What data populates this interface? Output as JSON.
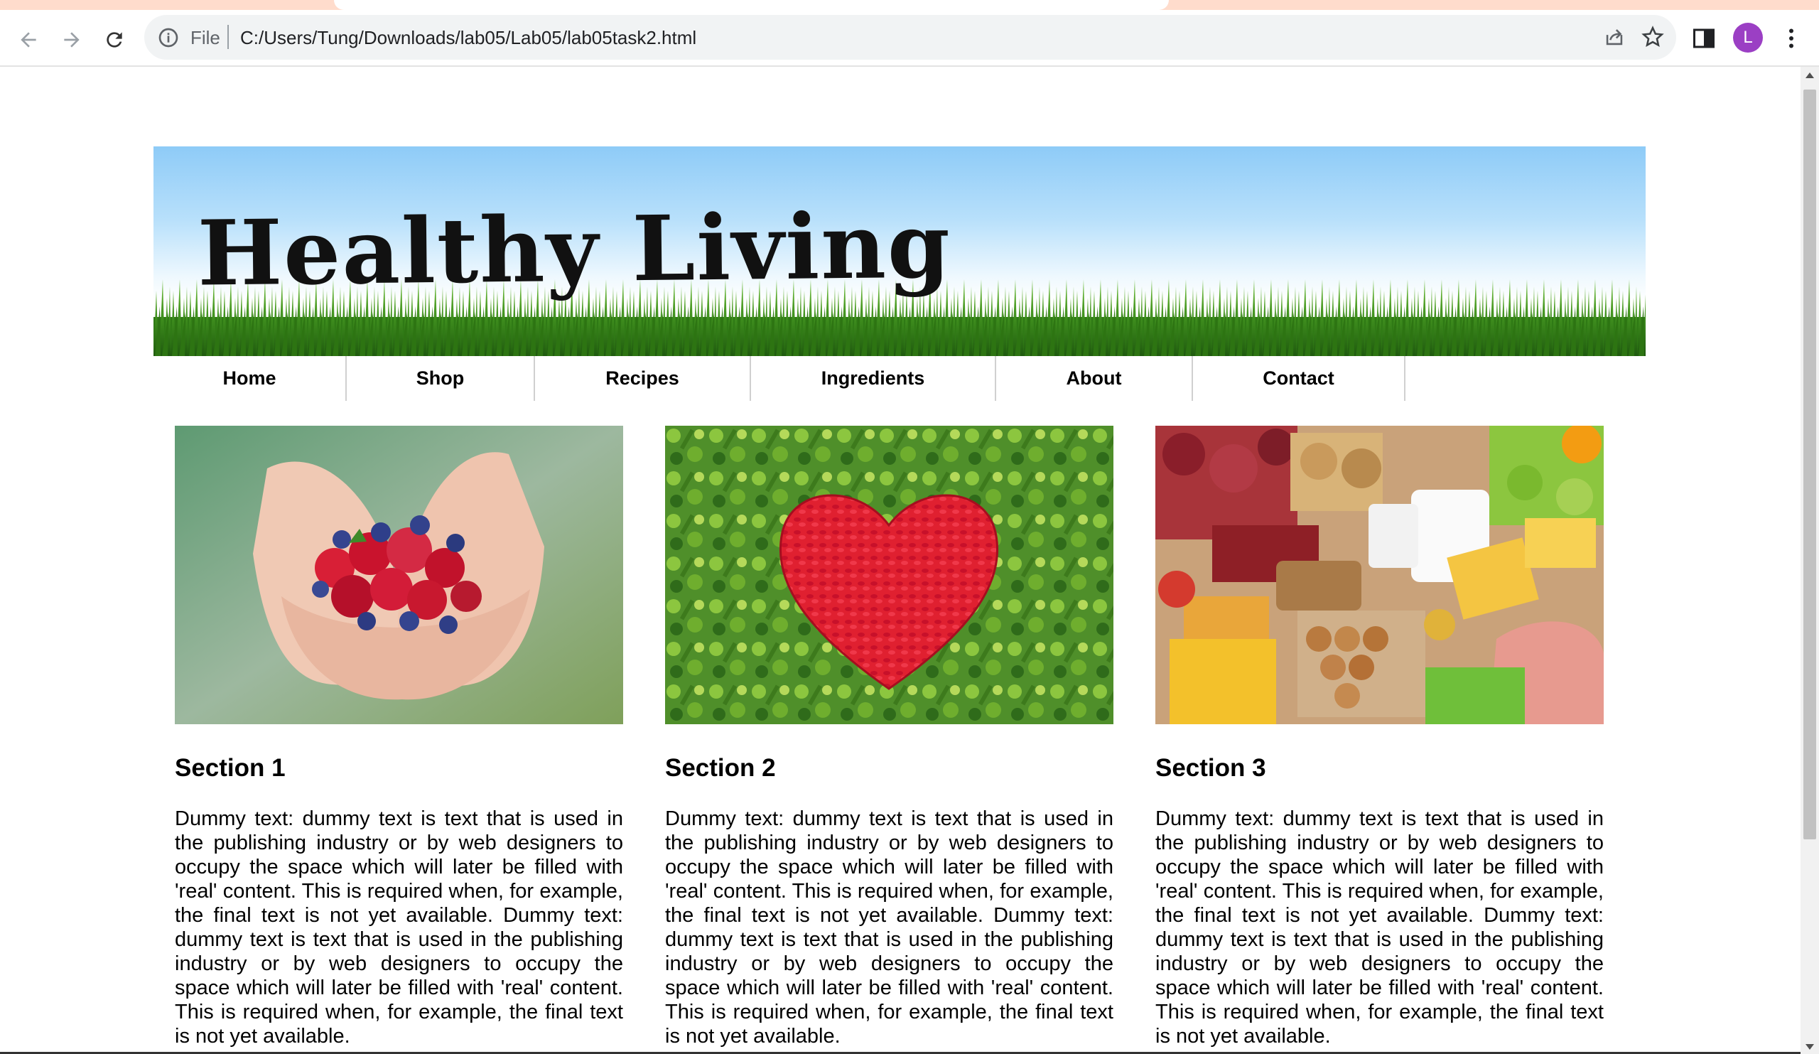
{
  "browser": {
    "scheme_label": "File",
    "url": "C:/Users/Tung/Downloads/lab05/Lab05/lab05task2.html",
    "profile_initial": "L",
    "profile_color": "#9b3fc4"
  },
  "site": {
    "title": "Healthy Living"
  },
  "nav": [
    {
      "label": "Home"
    },
    {
      "label": "Shop"
    },
    {
      "label": "Recipes"
    },
    {
      "label": "Ingredients"
    },
    {
      "label": "About"
    },
    {
      "label": "Contact"
    }
  ],
  "sections": [
    {
      "image": "hands-holding-berries",
      "heading": "Section 1",
      "text": "Dummy text: dummy text is text that is used in the publishing industry or by web designers to occupy the space which will later be filled with 'real' content. This is required when, for example, the final text is not yet available. Dummy text: dummy text is text that is used in the publishing industry or by web designers to occupy the space which will later be filled with 'real' content. This is required when, for example, the final text is not yet available."
    },
    {
      "image": "vegetables-heart",
      "heading": "Section 2",
      "text": "Dummy text: dummy text is text that is used in the publishing industry or by web designers to occupy the space which will later be filled with 'real' content. This is required when, for example, the final text is not yet available. Dummy text: dummy text is text that is used in the publishing industry or by web designers to occupy the space which will later be filled with 'real' content. This is required when, for example, the final text is not yet available."
    },
    {
      "image": "assorted-groceries",
      "heading": "Section 3",
      "text": "Dummy text: dummy text is text that is used in the publishing industry or by web designers to occupy the space which will later be filled with 'real' content. This is required when, for example, the final text is not yet available. Dummy text: dummy text is text that is used in the publishing industry or by web designers to occupy the space which will later be filled with 'real' content. This is required when, for example, the final text is not yet available."
    }
  ],
  "colors": {
    "tab_strip": "#ffdccc",
    "sky_top": "#8ecbf7",
    "grass": "#3f8f1e"
  }
}
